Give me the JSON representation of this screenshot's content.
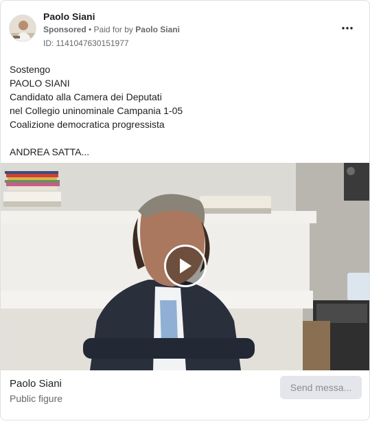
{
  "ad": {
    "page_name": "Paolo Siani",
    "sponsored_label": "Sponsored",
    "paid_for_prefix": "Paid for by",
    "paid_for_name": "Paolo Siani",
    "ad_id": "ID: 1141047630151977",
    "more_icon": "more-horizontal-icon",
    "body_text": "Sostengo\nPAOLO SIANI\nCandidato alla Camera dei Deputati\nnel Collegio uninominale Campania 1-05\nCoalizione democratica progressista\n\nANDREA SATTA..."
  },
  "media": {
    "type": "video",
    "play_icon": "play-icon"
  },
  "footer": {
    "title": "Paolo Siani",
    "subtitle": "Public figure",
    "cta_label": "Send messa..."
  },
  "colors": {
    "secondary_text": "#65676b",
    "cta_bg": "#e4e6eb",
    "border": "#dddfe2"
  }
}
